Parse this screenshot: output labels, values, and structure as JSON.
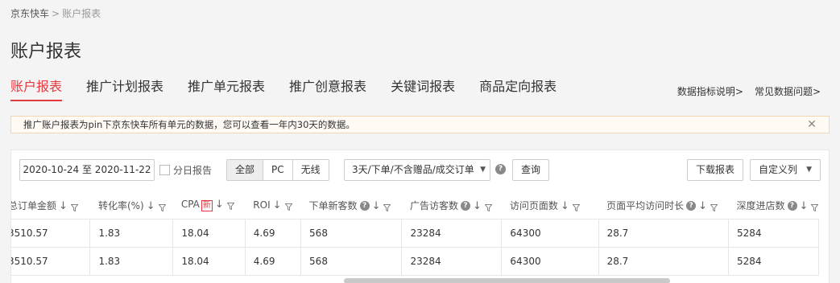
{
  "breadcrumb": {
    "root": "京东快车",
    "separator": ">",
    "current": "账户报表"
  },
  "page_title": "账户报表",
  "tabs": [
    {
      "label": "账户报表",
      "active": true
    },
    {
      "label": "推广计划报表"
    },
    {
      "label": "推广单元报表"
    },
    {
      "label": "推广创意报表"
    },
    {
      "label": "关键词报表"
    },
    {
      "label": "商品定向报表"
    }
  ],
  "help_links": {
    "metrics": "数据指标说明>",
    "faq": "常见数据问题>"
  },
  "notice": {
    "text": "推广账户报表为pin下京东快车所有单元的数据，您可以查看一年内30天的数据。",
    "close": "✕"
  },
  "filters": {
    "date_range": "2020-10-24 至 2020-11-22",
    "daily_report_label": "分日报告",
    "device_options": [
      "全部",
      "PC",
      "无线"
    ],
    "device_selected": "全部",
    "attribution": "3天/下单/不含赠品/成交订单",
    "query_label": "查询",
    "download_label": "下载报表",
    "custom_label": "自定义列"
  },
  "table": {
    "columns": [
      {
        "label": "总订单金额",
        "help": false,
        "new": false
      },
      {
        "label": "转化率(%)",
        "help": false,
        "new": false
      },
      {
        "label": "CPA",
        "help": false,
        "new": true,
        "new_label": "新"
      },
      {
        "label": "ROI",
        "help": false,
        "new": false
      },
      {
        "label": "下单新客数",
        "help": true,
        "new": false
      },
      {
        "label": "广告访客数",
        "help": true,
        "new": false
      },
      {
        "label": "访问页面数",
        "help": false,
        "new": false
      },
      {
        "label": "页面平均访问时长",
        "help": true,
        "new": false
      },
      {
        "label": "深度进店数",
        "help": true,
        "new": false
      }
    ],
    "rows": [
      [
        "3510.57",
        "1.83",
        "18.04",
        "4.69",
        "568",
        "23284",
        "64300",
        "28.7",
        "5284"
      ],
      [
        "3510.57",
        "1.83",
        "18.04",
        "4.69",
        "568",
        "23284",
        "64300",
        "28.7",
        "5284"
      ]
    ]
  },
  "colors": {
    "accent": "#e4393c",
    "notice_bg": "#fffaf3",
    "notice_border": "#f5d6b3"
  }
}
